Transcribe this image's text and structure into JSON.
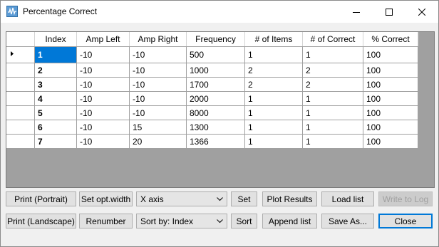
{
  "window": {
    "title": "Percentage Correct"
  },
  "table": {
    "columns": [
      "Index",
      "Amp Left",
      "Amp Right",
      "Frequency",
      "# of Items",
      "# of Correct",
      "% Correct"
    ],
    "rows": [
      [
        "1",
        "-10",
        "-10",
        "500",
        "1",
        "1",
        "100"
      ],
      [
        "2",
        "-10",
        "-10",
        "1000",
        "2",
        "2",
        "100"
      ],
      [
        "3",
        "-10",
        "-10",
        "1700",
        "2",
        "2",
        "100"
      ],
      [
        "4",
        "-10",
        "-10",
        "2000",
        "1",
        "1",
        "100"
      ],
      [
        "5",
        "-10",
        "-10",
        "8000",
        "1",
        "1",
        "100"
      ],
      [
        "6",
        "-10",
        "15",
        "1300",
        "1",
        "1",
        "100"
      ],
      [
        "7",
        "-10",
        "20",
        "1366",
        "1",
        "1",
        "100"
      ]
    ],
    "selected_row": 0
  },
  "buttons": {
    "print_portrait": "Print (Portrait)",
    "set_opt_width": "Set opt.width",
    "set": "Set",
    "plot_results": "Plot Results",
    "load_list": "Load list",
    "write_to_log": "Write to Log",
    "print_landscape": "Print (Landscape)",
    "renumber": "Renumber",
    "sort": "Sort",
    "append_list": "Append list",
    "save_as": "Save As...",
    "close": "Close"
  },
  "combos": {
    "axis": "X axis",
    "sort_by": "Sort by: Index"
  },
  "colors": {
    "selection": "#0078d7",
    "grid_background": "#a0a0a0"
  }
}
